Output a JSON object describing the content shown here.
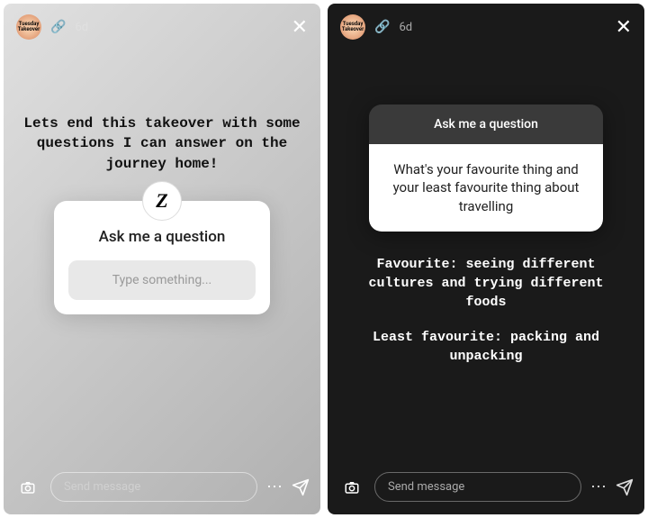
{
  "stories": {
    "left": {
      "username": "Tuesday Takeover",
      "timestamp": "6d",
      "caption": "Lets end this takeover with some questions I can answer on the journey home!",
      "qcard": {
        "avatar_letter": "Z",
        "title": "Ask me a question",
        "placeholder": "Type something..."
      },
      "footer": {
        "message_placeholder": "Send message"
      }
    },
    "right": {
      "username": "Tuesday Takeover",
      "timestamp": "6d",
      "answer_card": {
        "header": "Ask me a question",
        "body": "What's your favourite thing and your least favourite thing about travelling"
      },
      "answers": {
        "fav": "Favourite: seeing different cultures and trying different foods",
        "least": "Least favourite: packing and unpacking"
      },
      "footer": {
        "message_placeholder": "Send message"
      }
    }
  }
}
